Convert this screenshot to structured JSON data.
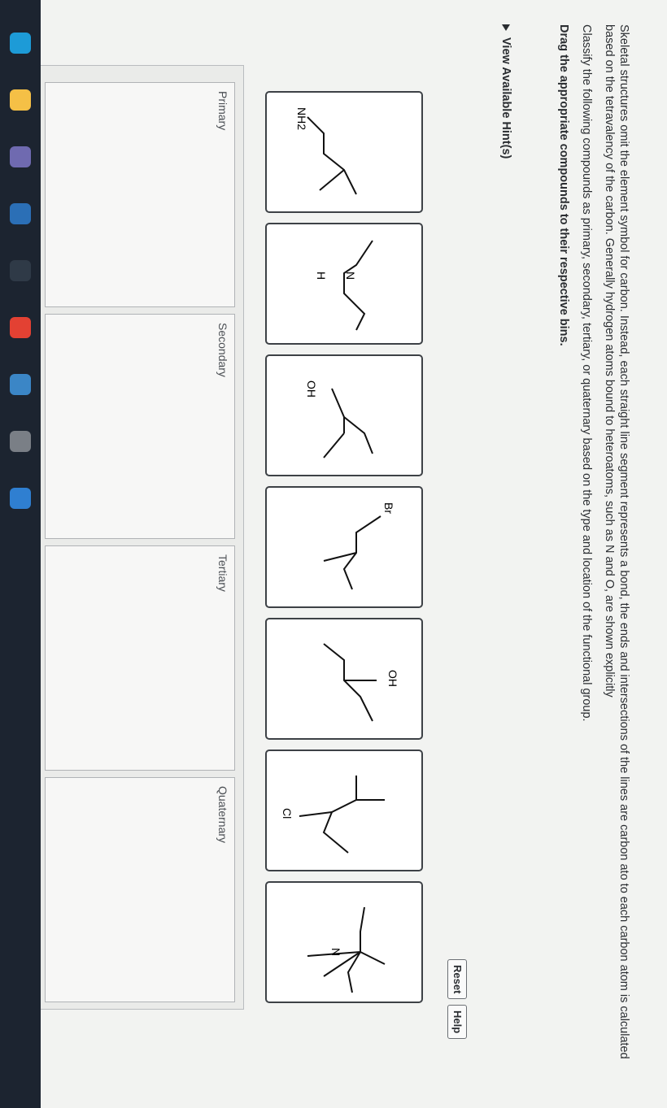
{
  "instructions": {
    "paragraph1": "Skeletal structures omit the element symbol for carbon. Instead, each straight line segment represents a bond, the ends and intersections of the lines are carbon ato to each carbon atom is calculated based on the tetravalency of the carbon. Generally hydrogen atoms bound to heteroatoms, such as N and O, are shown explicitly",
    "paragraph2": "Classify the following compounds as primary, secondary, tertiary, or quaternary based on the type and location of the functional group.",
    "paragraph3": "Drag the appropriate compounds to their respective bins."
  },
  "hint_toggle": "View Available Hint(s)",
  "buttons": {
    "reset": "Reset",
    "help": "Help"
  },
  "compounds": [
    {
      "label": "NH2",
      "label_sub": "2"
    },
    {
      "label": "N",
      "label2": "H"
    },
    {
      "label": "OH"
    },
    {
      "label": "Br"
    },
    {
      "label": "OH"
    },
    {
      "label": "Cl"
    },
    {
      "label": "N",
      "label_sup": "+"
    }
  ],
  "bins": [
    "Primary",
    "Secondary",
    "Tertiary",
    "Quaternary"
  ],
  "colors": {
    "tile_border": "#3d4146",
    "bin_bg": "#f7f7f6",
    "page_bg": "#f2f3f1"
  },
  "taskbar_icons": [
    "edge-icon",
    "file-explorer-icon",
    "store-icon",
    "apps-icon",
    "amazon-icon",
    "chrome-icon",
    "photos-icon",
    "settings-icon",
    "outlook-icon"
  ]
}
